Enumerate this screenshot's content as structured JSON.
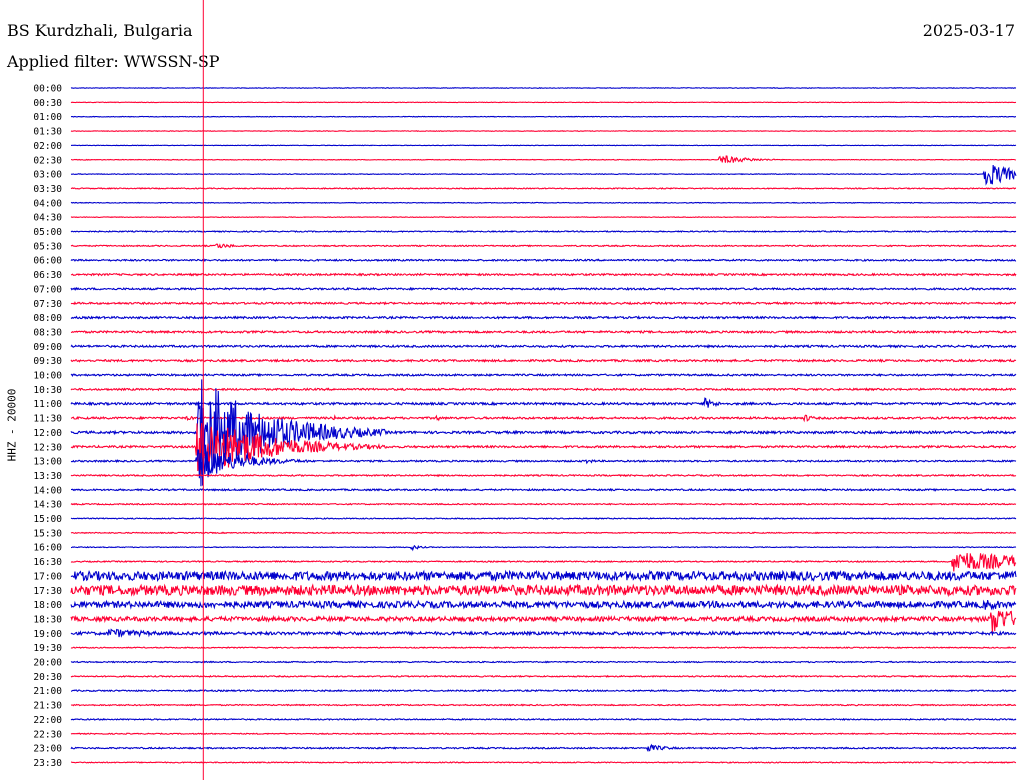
{
  "header": {
    "station": "BS Kurdzhali, Bulgaria",
    "date": "2025-03-17",
    "filter": "Applied filter: WWSSN-SP"
  },
  "chart_data": {
    "type": "line",
    "title": "BS Kurdzhali, Bulgaria",
    "date": "2025-03-17",
    "subtitle": "Applied filter: WWSSN-SP",
    "ylabel": "HHZ - 20000",
    "xlabel": "",
    "y_tick_labels": [
      "00:00",
      "00:30",
      "01:00",
      "01:30",
      "02:00",
      "02:30",
      "03:00",
      "03:30",
      "04:00",
      "04:30",
      "05:00",
      "05:30",
      "06:00",
      "06:30",
      "07:00",
      "07:30",
      "08:00",
      "08:30",
      "09:00",
      "09:30",
      "10:00",
      "10:30",
      "11:00",
      "11:30",
      "12:00",
      "12:30",
      "13:00",
      "13:30",
      "14:00",
      "14:30",
      "15:00",
      "15:30",
      "16:00",
      "16:30",
      "17:00",
      "17:30",
      "18:00",
      "18:30",
      "19:00",
      "19:30",
      "20:00",
      "20:30",
      "21:00",
      "21:30",
      "22:00",
      "22:30",
      "23:00",
      "23:30"
    ],
    "trace_colors": [
      "#0000cc",
      "#ff0033"
    ],
    "x_range_minutes": [
      0,
      30
    ],
    "marker_minute": 4.2,
    "trace_noise": [
      0.3,
      0.25,
      0.3,
      0.3,
      0.25,
      0.3,
      0.35,
      0.5,
      0.35,
      0.3,
      0.55,
      0.6,
      0.8,
      0.9,
      0.9,
      0.9,
      1.0,
      1.0,
      1.0,
      1.0,
      0.9,
      0.9,
      1.1,
      1.0,
      1.2,
      1.0,
      0.8,
      0.7,
      0.8,
      0.6,
      0.5,
      0.5,
      0.4,
      0.6,
      4.5,
      5.0,
      3.2,
      2.2,
      1.5,
      0.5,
      0.6,
      0.6,
      0.7,
      0.6,
      0.6,
      0.5,
      0.7,
      0.5
    ],
    "events": [
      {
        "trace": "02:30",
        "minute": 20.6,
        "amplitude": 5,
        "duration": 0.8
      },
      {
        "trace": "03:00",
        "minute": 29.0,
        "amplitude": 14,
        "duration": 0.9
      },
      {
        "trace": "05:30",
        "minute": 4.6,
        "amplitude": 3,
        "duration": 0.6
      },
      {
        "trace": "11:00",
        "minute": 20.1,
        "amplitude": 6,
        "duration": 0.4
      },
      {
        "trace": "11:30",
        "minute": 3.7,
        "amplitude": 3,
        "duration": 0.2
      },
      {
        "trace": "11:30",
        "minute": 8.3,
        "amplitude": 3,
        "duration": 0.2
      },
      {
        "trace": "11:30",
        "minute": 11.6,
        "amplitude": 3,
        "duration": 0.2
      },
      {
        "trace": "11:30",
        "minute": 23.3,
        "amplitude": 5,
        "duration": 0.2
      },
      {
        "trace": "12:00",
        "minute": 4.0,
        "amplitude": 60,
        "duration": 2.0
      },
      {
        "trace": "12:30",
        "minute": 4.0,
        "amplitude": 35,
        "duration": 2.0
      },
      {
        "trace": "13:00",
        "minute": 4.0,
        "amplitude": 22,
        "duration": 1.2
      },
      {
        "trace": "13:00",
        "minute": 16.3,
        "amplitude": 3,
        "duration": 0.3
      },
      {
        "trace": "16:00",
        "minute": 10.8,
        "amplitude": 3,
        "duration": 0.3
      },
      {
        "trace": "16:30",
        "minute": 28.0,
        "amplitude": 12,
        "duration": 2.5
      },
      {
        "trace": "18:00",
        "minute": 29.0,
        "amplitude": 6,
        "duration": 1.0
      },
      {
        "trace": "18:30",
        "minute": 29.2,
        "amplitude": 16,
        "duration": 0.9
      },
      {
        "trace": "19:00",
        "minute": 1.2,
        "amplitude": 5,
        "duration": 1.5
      },
      {
        "trace": "23:00",
        "minute": 18.3,
        "amplitude": 4,
        "duration": 0.6
      }
    ],
    "grid": false,
    "legend": "none"
  }
}
